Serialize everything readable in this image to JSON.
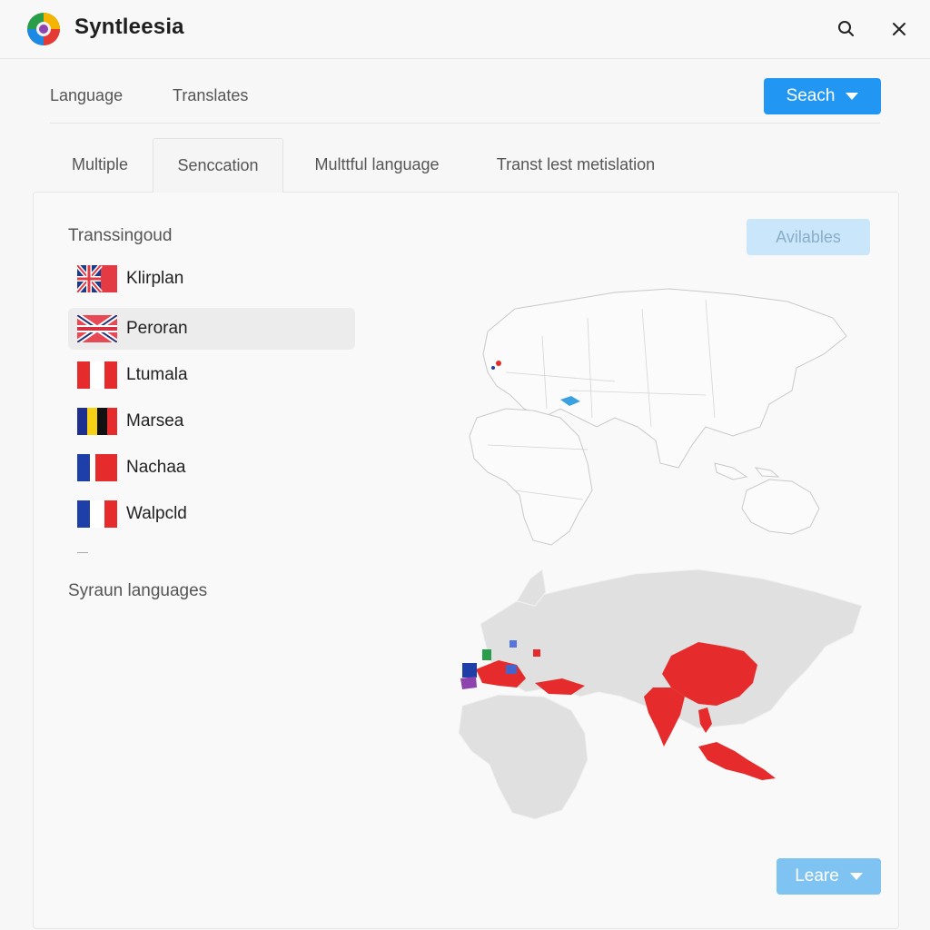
{
  "app": {
    "title": "Syntleesia"
  },
  "titlebar": {
    "search_icon": "search-icon",
    "close_icon": "close-icon"
  },
  "topnav": {
    "links": [
      {
        "label": "Language"
      },
      {
        "label": "Translates"
      }
    ],
    "search_button": {
      "label": "Seach",
      "icon": "chevron-down-icon"
    }
  },
  "tabs": [
    {
      "label": "Multiple",
      "active": false
    },
    {
      "label": "Senccation",
      "active": true
    },
    {
      "label": "Multtful language",
      "active": false
    },
    {
      "label": "Transt lest metislation",
      "active": false
    }
  ],
  "panel": {
    "section_title": "Transsingoud",
    "available_button": {
      "label": "Avilables"
    },
    "languages": [
      {
        "name": "Klirplan",
        "flag": "union-jack",
        "selected": false
      },
      {
        "name": "Peroran",
        "flag": "union-jack",
        "selected": true
      },
      {
        "name": "Ltumala",
        "flag": "red-white-red",
        "selected": false
      },
      {
        "name": "Marsea",
        "flag": "blue-yellow-black-red",
        "selected": false
      },
      {
        "name": "Nachaa",
        "flag": "blue-red",
        "selected": false
      },
      {
        "name": "Walpcld",
        "flag": "blue-white-red",
        "selected": false
      }
    ],
    "secondary_title": "Syraun languages",
    "bottom_button": {
      "label": "Leare",
      "icon": "chevron-down-icon"
    }
  },
  "colors": {
    "accent": "#2196f3",
    "accent_light": "#c9e6fb",
    "highlight_red": "#e52b2b",
    "land_gray": "#e0e0e0"
  }
}
